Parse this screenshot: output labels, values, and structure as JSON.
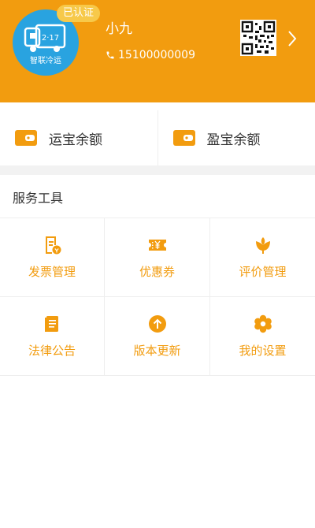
{
  "profile": {
    "name": "小九",
    "phone": "15100000009",
    "verified_badge": "已认证",
    "avatar_text": "智联冷运",
    "avatar_plate": "2·17"
  },
  "balances": [
    {
      "label": "运宝余额",
      "icon": "wallet-icon"
    },
    {
      "label": "盈宝余额",
      "icon": "wallet-icon"
    }
  ],
  "services": {
    "title": "服务工具",
    "items": [
      {
        "label": "发票管理",
        "icon": "invoice-icon"
      },
      {
        "label": "优惠券",
        "icon": "coupon-icon"
      },
      {
        "label": "评价管理",
        "icon": "flower-icon"
      },
      {
        "label": "法律公告",
        "icon": "document-icon"
      },
      {
        "label": "版本更新",
        "icon": "upload-arrow-icon"
      },
      {
        "label": "我的设置",
        "icon": "settings-icon"
      }
    ]
  },
  "colors": {
    "brand": "#f29c0f",
    "avatar_bg": "#29a3e0",
    "badge": "#f7c94a"
  }
}
